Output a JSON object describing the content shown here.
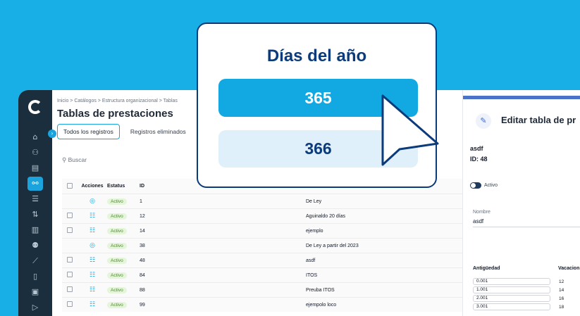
{
  "colors": {
    "background": "#18aee6",
    "sidebar": "#1a2e3d",
    "accent": "#1aa3dc",
    "navy": "#0b3b7a",
    "status_active_bg": "#e4f5d9",
    "status_active_text": "#4a8c2a"
  },
  "sidebar": {
    "logo": "C",
    "icons": [
      {
        "name": "home-icon",
        "glyph": "⌂"
      },
      {
        "name": "users-icon",
        "glyph": "⚇"
      },
      {
        "name": "id-card-icon",
        "glyph": "▤"
      },
      {
        "name": "org-chart-icon",
        "glyph": "⚯"
      },
      {
        "name": "list-icon",
        "glyph": "☰"
      },
      {
        "name": "transfer-icon",
        "glyph": "⇅"
      },
      {
        "name": "database-icon",
        "glyph": "▥"
      },
      {
        "name": "people-icon",
        "glyph": "⚉"
      },
      {
        "name": "chart-icon",
        "glyph": "⟋"
      },
      {
        "name": "document-icon",
        "glyph": "▯"
      },
      {
        "name": "folder-icon",
        "glyph": "▣"
      },
      {
        "name": "logout-icon",
        "glyph": "▷"
      }
    ],
    "collapse_glyph": "›"
  },
  "header": {
    "breadcrumb": "Inicio  >  Catálogos  >  Estructura organizacional  >  Tablas",
    "title": "Tablas de prestaciones"
  },
  "tabs": [
    {
      "label": "Todos los registros"
    },
    {
      "label": "Registros eliminados"
    }
  ],
  "search": {
    "placeholder": "Buscar",
    "icon_glyph": "⚲"
  },
  "table": {
    "headers": {
      "acciones": "Acciones",
      "estatus": "Estatus",
      "id": "ID"
    },
    "rows": [
      {
        "checkbox": false,
        "action": "view",
        "action_glyph": "◎",
        "status": "Activo",
        "id": "1",
        "name": "De Ley"
      },
      {
        "checkbox": true,
        "action": "menu",
        "action_glyph": "☷",
        "status": "Activo",
        "id": "12",
        "name": "Aguinaldo 20 días"
      },
      {
        "checkbox": true,
        "action": "menu",
        "action_glyph": "☷",
        "status": "Activo",
        "id": "14",
        "name": "ejemplo"
      },
      {
        "checkbox": false,
        "action": "view",
        "action_glyph": "◎",
        "status": "Activo",
        "id": "38",
        "name": "De Ley a partir del 2023"
      },
      {
        "checkbox": true,
        "action": "menu",
        "action_glyph": "☷",
        "status": "Activo",
        "id": "48",
        "name": "asdf"
      },
      {
        "checkbox": true,
        "action": "menu",
        "action_glyph": "☷",
        "status": "Activo",
        "id": "84",
        "name": "ITOS"
      },
      {
        "checkbox": true,
        "action": "menu",
        "action_glyph": "☷",
        "status": "Activo",
        "id": "88",
        "name": "Preuba ITOS"
      },
      {
        "checkbox": true,
        "action": "menu",
        "action_glyph": "☷",
        "status": "Activo",
        "id": "99",
        "name": "ejempolo loco"
      }
    ]
  },
  "panel": {
    "title": "Editar tabla de pr",
    "pencil_glyph": "✎",
    "name": "asdf",
    "id_label": "ID: 48",
    "toggle_label": "Activo",
    "toggle_on": true,
    "field_label": "Nombre",
    "field_value": "asdf",
    "antiguedad_header": "Antigüedad",
    "vacaciones_header": "Vacacion",
    "rows": [
      {
        "antiguedad": "0.001",
        "vacaciones": "12"
      },
      {
        "antiguedad": "1.001",
        "vacaciones": "14"
      },
      {
        "antiguedad": "2.001",
        "vacaciones": "16"
      },
      {
        "antiguedad": "3.001",
        "vacaciones": "18"
      }
    ]
  },
  "popup": {
    "title": "Días del año",
    "option_1": "365",
    "option_2": "366"
  }
}
